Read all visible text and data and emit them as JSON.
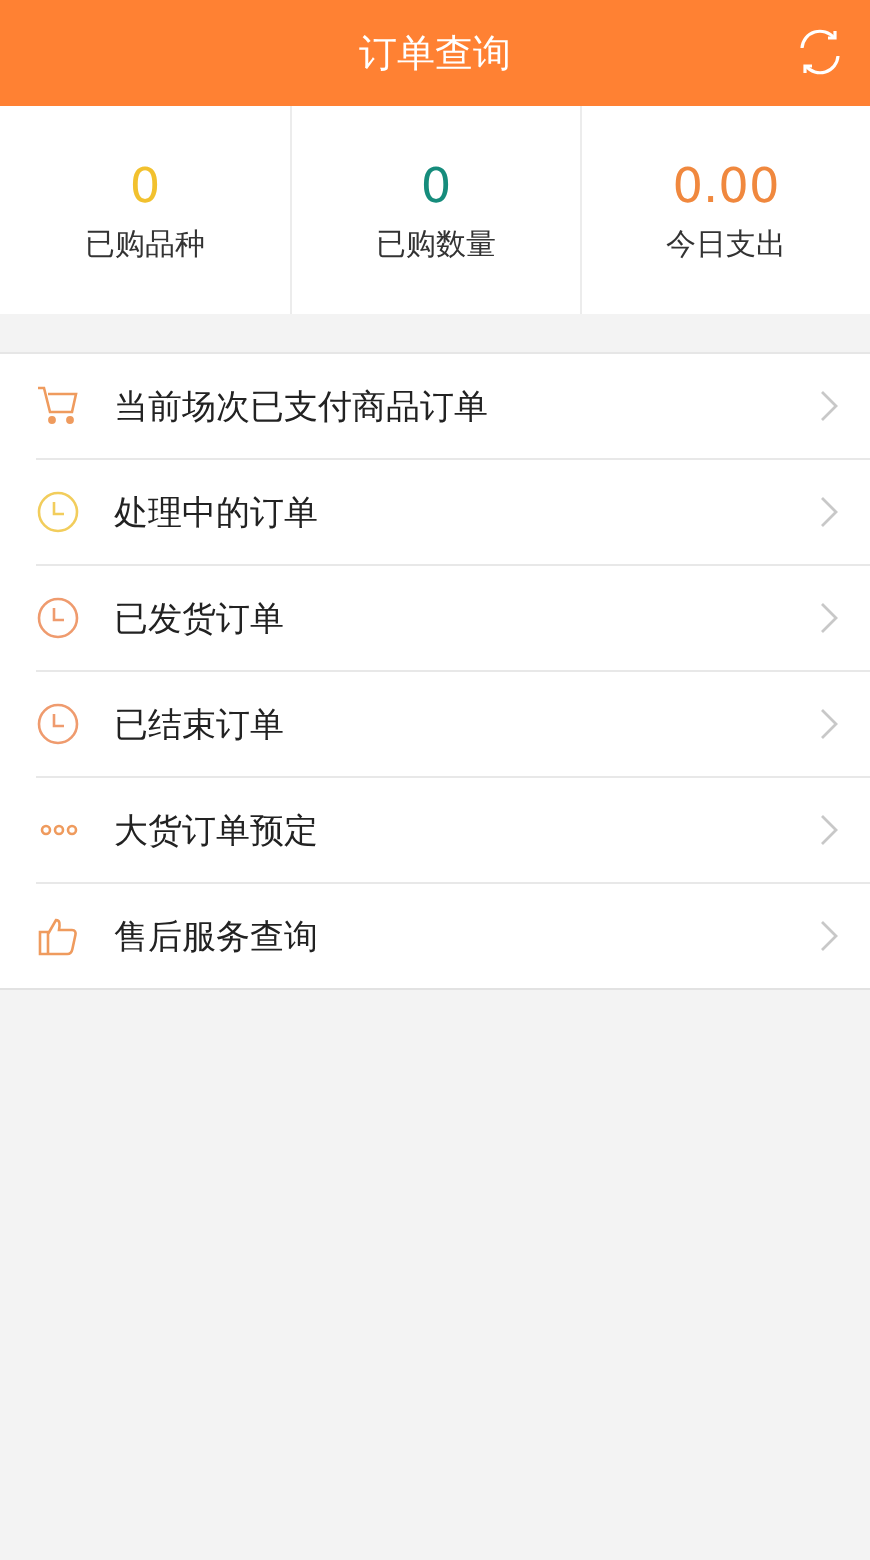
{
  "header": {
    "title": "订单查询"
  },
  "stats": [
    {
      "value": "0",
      "label": "已购品种",
      "color": "#f2c12e"
    },
    {
      "value": "0",
      "label": "已购数量",
      "color": "#168c7c"
    },
    {
      "value": "0.00",
      "label": "今日支出",
      "color": "#f0883e"
    }
  ],
  "menu": [
    {
      "kind": "cart",
      "label": "当前场次已支付商品订单",
      "color": "#ef9b5e"
    },
    {
      "kind": "clock",
      "label": "处理中的订单",
      "color": "#f2cd5c"
    },
    {
      "kind": "clock",
      "label": "已发货订单",
      "color": "#ef9b6e"
    },
    {
      "kind": "clock",
      "label": "已结束订单",
      "color": "#ef9b6e"
    },
    {
      "kind": "dots",
      "label": "大货订单预定",
      "color": "#ef9b5e"
    },
    {
      "kind": "thumb",
      "label": "售后服务查询",
      "color": "#ef9b5e"
    }
  ]
}
